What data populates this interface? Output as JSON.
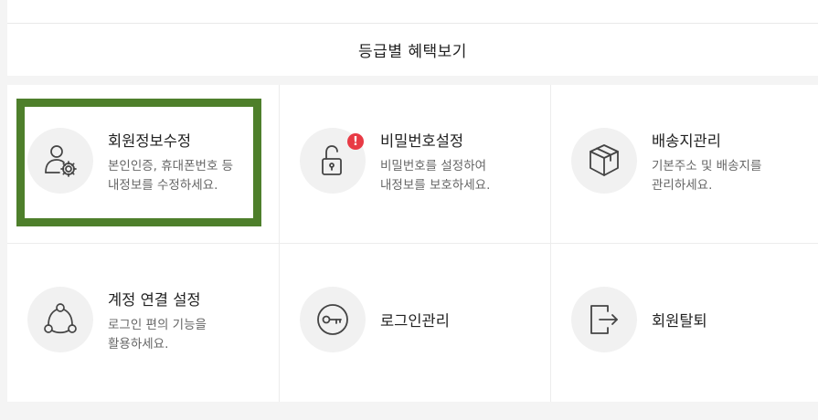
{
  "grade_benefits_label": "등급별 혜택보기",
  "menu": [
    {
      "title": "회원정보수정",
      "desc1": "본인인증, 휴대폰번호 등",
      "desc2": "내정보를 수정하세요.",
      "icon": "user-gear-icon"
    },
    {
      "title": "비밀번호설정",
      "desc1": "비밀번호를 설정하여",
      "desc2": "내정보를 보호하세요.",
      "icon": "unlock-icon",
      "badge": "!"
    },
    {
      "title": "배송지관리",
      "desc1": "기본주소 및 배송지를",
      "desc2": "관리하세요.",
      "icon": "box-icon"
    },
    {
      "title": "계정 연결 설정",
      "desc1": "로그인 편의 기능을",
      "desc2": "활용하세요.",
      "icon": "share-nodes-icon"
    },
    {
      "title": "로그인관리",
      "icon": "key-icon"
    },
    {
      "title": "회원탈퇴",
      "icon": "exit-icon"
    }
  ],
  "colors": {
    "highlight": "#4e7f2b",
    "badge": "#e83a45",
    "icon_bg": "#f1f1f1"
  }
}
